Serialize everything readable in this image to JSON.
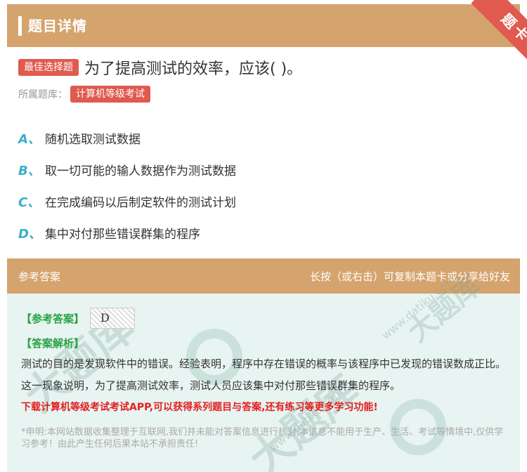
{
  "header": {
    "title": "题目详情",
    "ribbon": "题卡"
  },
  "question": {
    "type_tag": "最佳选择题",
    "text": "为了提高测试的效率，应该( )。",
    "bank_label": "所属题库：",
    "bank_name": "计算机等级考试"
  },
  "options": [
    {
      "letter": "A、",
      "text": "随机选取测试数据"
    },
    {
      "letter": "B、",
      "text": "取一切可能的输人数据作为测试数据"
    },
    {
      "letter": "C、",
      "text": "在完成编码以后制定软件的测试计划"
    },
    {
      "letter": "D、",
      "text": "集中对付那些错误群集的程序"
    }
  ],
  "answer": {
    "head_left": "参考答案",
    "head_right": "长按（或右击）可复制本题卡或分享给好友",
    "answer_label": "【参考答案】",
    "answer_value": "D",
    "analysis_label": "【答案解析】",
    "analysis_text": "测试的目的是发现软件中的错误。经验表明，程序中存在错误的概率与该程序中已发现的错误数成正比。这一现象说明，为了提高测试效率，测试人员应该集中对付那些错误群集的程序。",
    "promo": "下载计算机等级考试考试APP,可以获得系列题目与答案,还有练习等更多学习功能!",
    "disclaimer": "*申明:本网站数据收集整理于互联网,我们并未能对答案信息进行核对,本信息不能用于生产、生活、考试等情境中,仅供学习参考！由此产生任何后果本站不承担责任!"
  },
  "watermark": {
    "text": "大题库",
    "url": "www.datiku.com"
  },
  "colors": {
    "header": "#d5a36d",
    "tag": "#e05a4f",
    "option_letter": "#3ab0c8",
    "green": "#27a345",
    "promo": "#e02020"
  }
}
